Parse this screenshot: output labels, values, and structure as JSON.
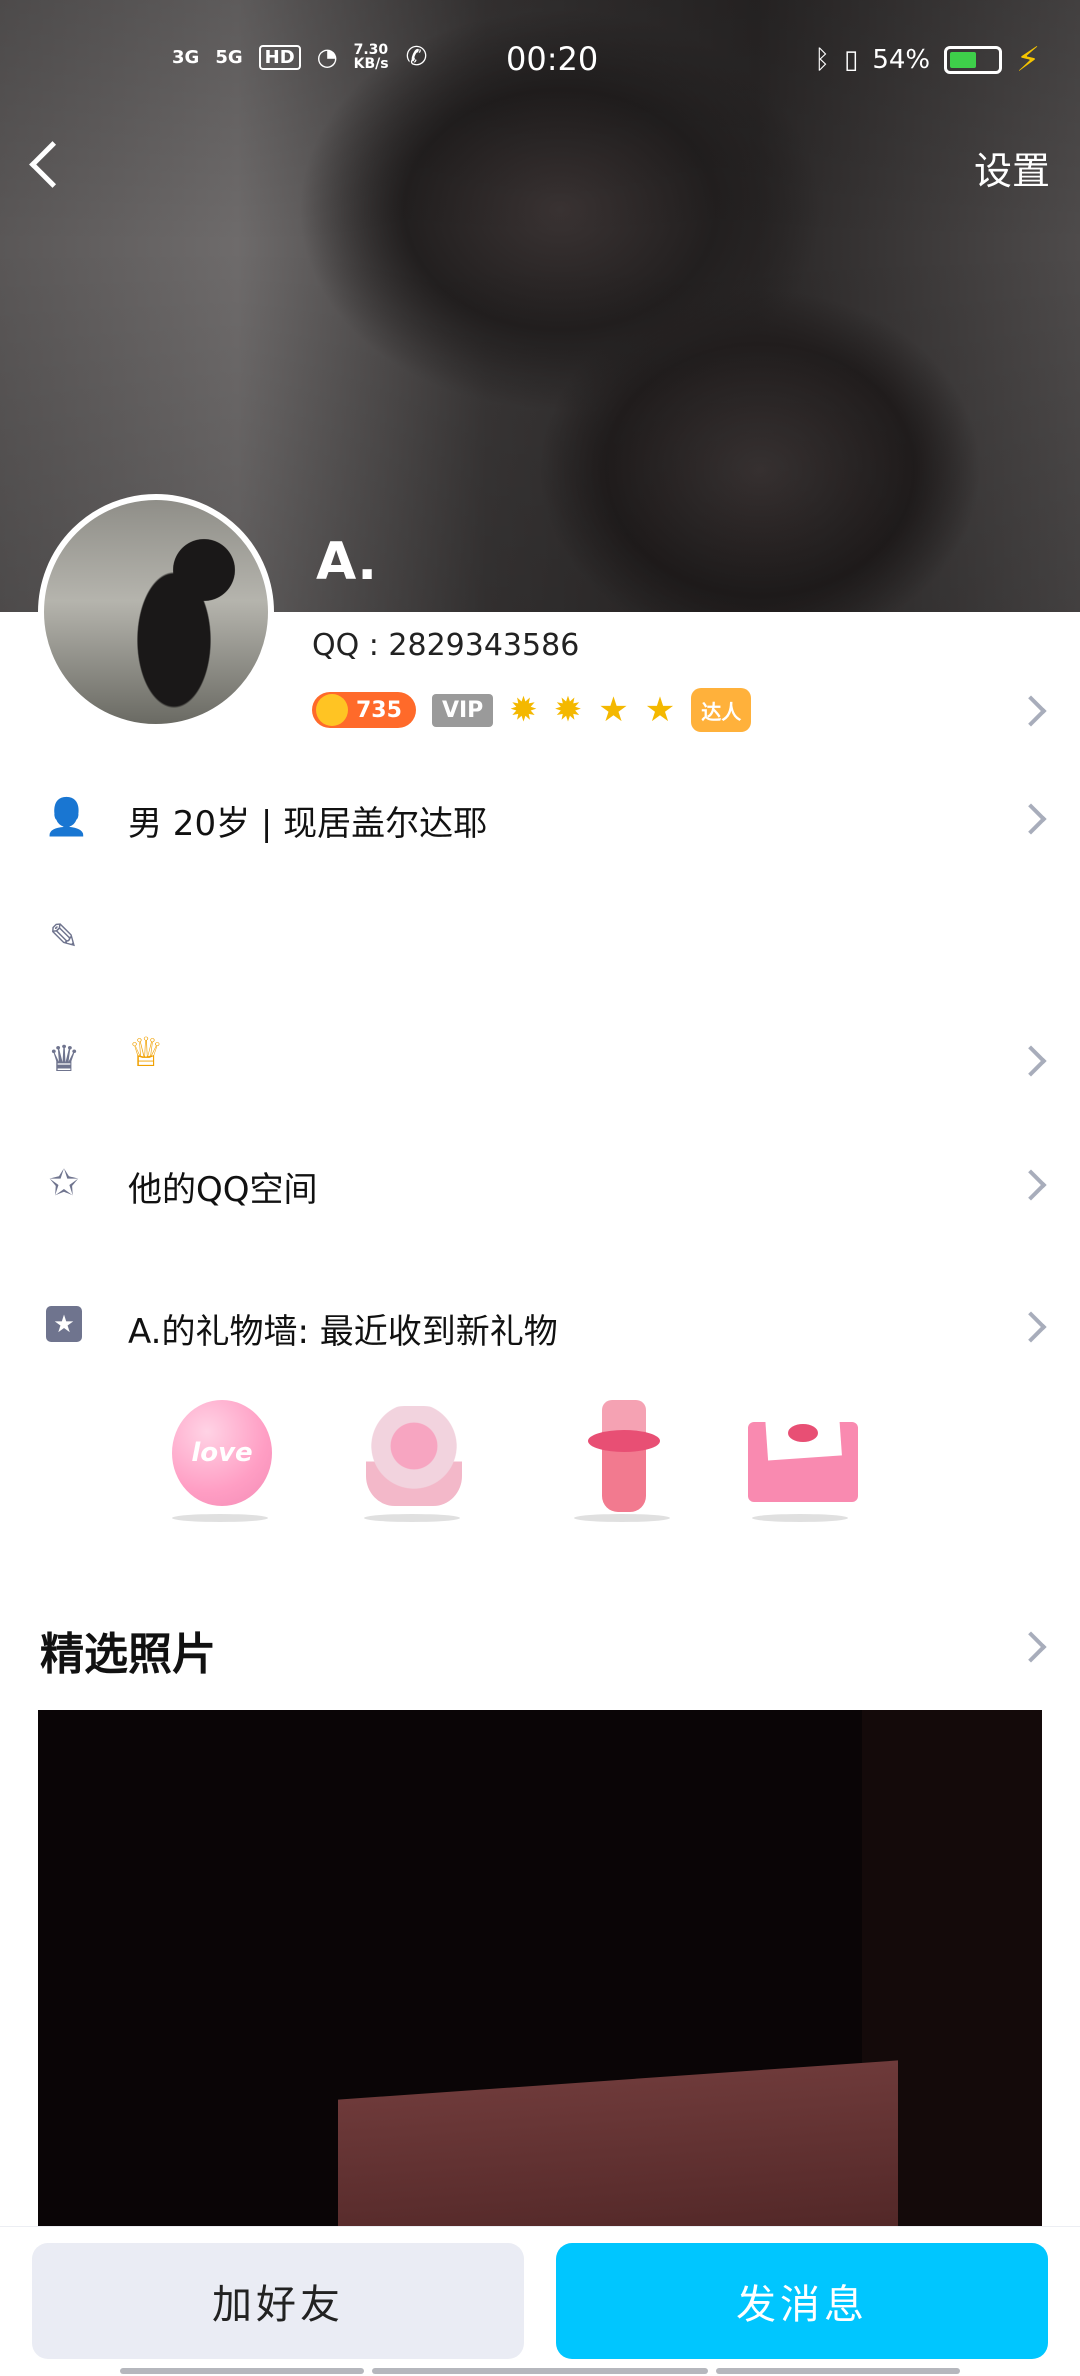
{
  "status_bar": {
    "network_1": "3G",
    "network_2": "5G",
    "hd": "HD",
    "speed": "7.30 KB/s",
    "time": "00:20",
    "battery_percent": "54%",
    "battery_level": 0.54
  },
  "header": {
    "settings_label": "设置"
  },
  "profile": {
    "name": "A.",
    "qq_line": "QQ : 2829343586",
    "coin_count": "735",
    "vip_label": "VIP",
    "star_count": 4,
    "daren_label": "达人"
  },
  "info_rows": {
    "basic": "男  20岁  |  现居盖尔达耶",
    "signature": "",
    "qzone": "他的QQ空间",
    "gift_wall": "A.的礼物墙: 最近收到新礼物"
  },
  "gifts": [
    {
      "name": "balloon",
      "text": "love"
    },
    {
      "name": "bouquet",
      "text": ""
    },
    {
      "name": "bottle",
      "text": ""
    },
    {
      "name": "envelope",
      "text": ""
    }
  ],
  "featured": {
    "title": "精选照片"
  },
  "actions": {
    "add_friend": "加好友",
    "send_message": "发消息"
  },
  "colors": {
    "accent": "#00c6ff",
    "icon": "#6f748e",
    "coin": "#ff6a2a"
  }
}
